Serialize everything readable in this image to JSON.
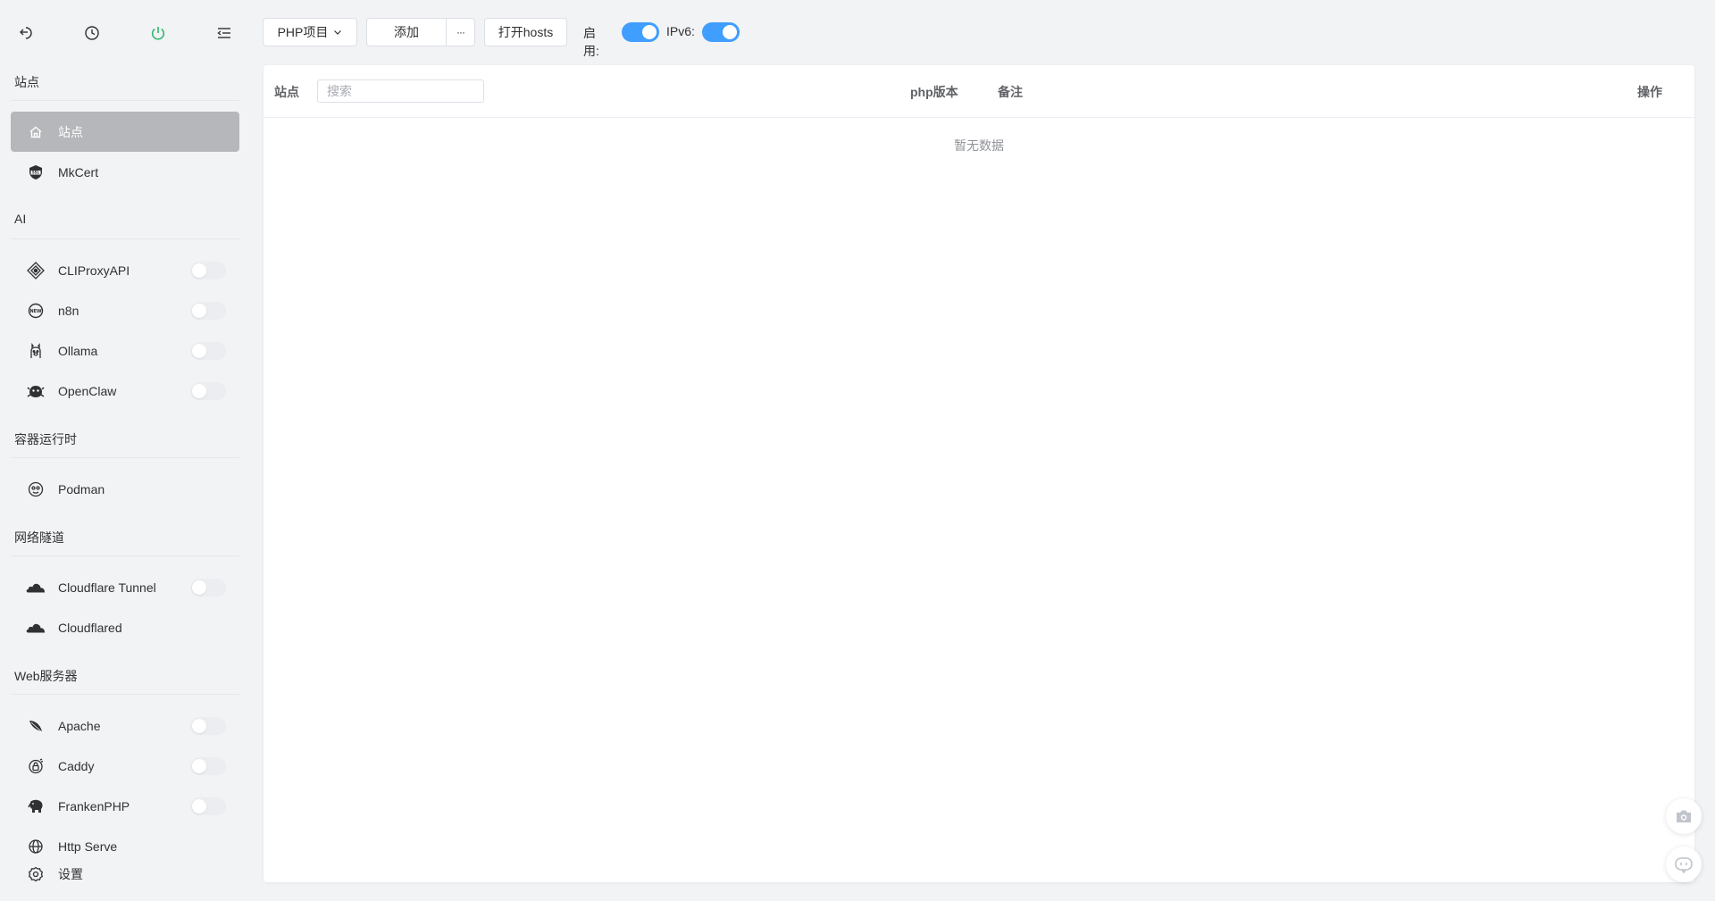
{
  "sidebar": {
    "sections": {
      "site": "站点",
      "ai": "AI",
      "container": "容器运行时",
      "tunnel": "网络隧道",
      "web": "Web服务器"
    },
    "items": {
      "site": "站点",
      "mkcert": "MkCert",
      "cliproxyapi": "CLIProxyAPI",
      "n8n": "n8n",
      "ollama": "Ollama",
      "openclaw": "OpenClaw",
      "podman": "Podman",
      "cloudflare_tunnel": "Cloudflare Tunnel",
      "cloudflared": "Cloudflared",
      "apache": "Apache",
      "caddy": "Caddy",
      "frankenphp": "FrankenPHP",
      "http_serve": "Http Serve",
      "settings": "设置"
    }
  },
  "toolbar": {
    "project_select": "PHP项目",
    "add_label": "添加",
    "more_label": "···",
    "open_hosts_label": "打开hosts",
    "enable_label": "启用:",
    "ipv6_label": "IPv6:",
    "enable_on": true,
    "ipv6_on": true
  },
  "table": {
    "col_site": "站点",
    "search_placeholder": "搜索",
    "col_php_version": "php版本",
    "col_note": "备注",
    "col_action": "操作",
    "empty_text": "暂无数据"
  },
  "colors": {
    "accent": "#409eff",
    "power": "#2fb86f",
    "active_bg": "#b5b7ba"
  }
}
